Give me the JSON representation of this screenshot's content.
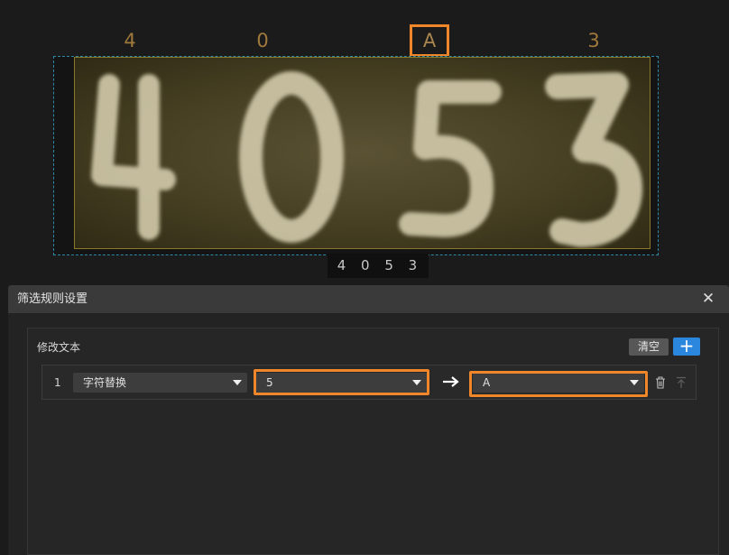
{
  "ocr_preview": {
    "chars": [
      "4",
      "0",
      "A",
      "3"
    ],
    "plate_text": [
      "4",
      "0",
      "5",
      "3"
    ],
    "result_text": "4 0 5 3"
  },
  "dialog": {
    "title": "筛选规则设置",
    "close_icon": "close-icon",
    "section_title": "修改文本",
    "clear_label": "清空",
    "add_icon": "plus-icon",
    "rules": [
      {
        "index": "1",
        "type": "字符替换",
        "from": "5",
        "to": "A"
      }
    ],
    "arrow_icon": "arrow-right-icon",
    "delete_icon": "trash-icon",
    "move_top_icon": "move-to-top-icon"
  },
  "colors": {
    "highlight": "#f0862a",
    "accent": "#2b86dd",
    "ocr_char": "#a07a3c"
  }
}
